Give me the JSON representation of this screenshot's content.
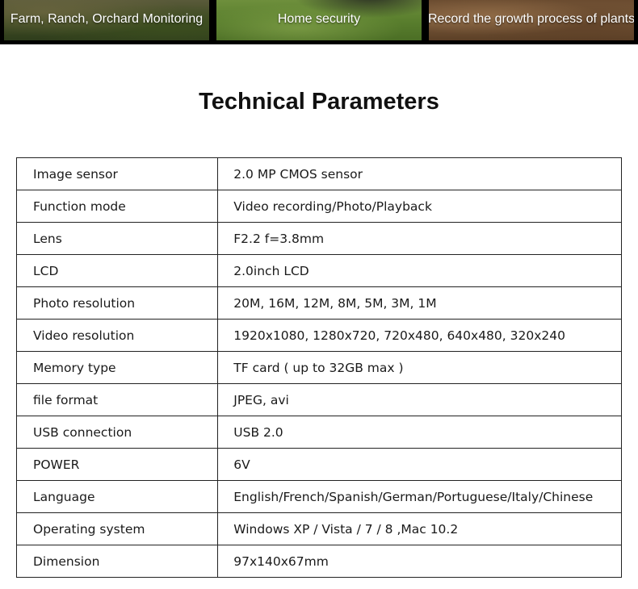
{
  "banners": [
    {
      "label": "Farm, Ranch, Orchard Monitoring"
    },
    {
      "label": "Home security"
    },
    {
      "label": "Record the growth process of plants"
    }
  ],
  "title": "Technical Parameters",
  "rows": [
    {
      "label": "Image sensor",
      "value": "2.0 MP CMOS sensor"
    },
    {
      "label": "Function mode",
      "value": "Video recording/Photo/Playback"
    },
    {
      "label": "Lens",
      "value": "F2.2  f=3.8mm"
    },
    {
      "label": "LCD",
      "value": "2.0inch LCD"
    },
    {
      "label": "Photo resolution",
      "value": "20M, 16M, 12M, 8M, 5M, 3M, 1M"
    },
    {
      "label": "Video resolution",
      "value": "1920x1080, 1280x720, 720x480, 640x480, 320x240"
    },
    {
      "label": "Memory type",
      "value": "TF card ( up to 32GB max )"
    },
    {
      "label": "file format",
      "value": "JPEG, avi"
    },
    {
      "label": "USB connection",
      "value": "USB 2.0"
    },
    {
      "label": "POWER",
      "value": "6V"
    },
    {
      "label": "Language",
      "value": "English/French/Spanish/German/Portuguese/Italy/Chinese"
    },
    {
      "label": "Operating system",
      "value": "Windows XP / Vista / 7 / 8 ,Mac 10.2"
    },
    {
      "label": "Dimension",
      "value": "97x140x67mm"
    }
  ]
}
